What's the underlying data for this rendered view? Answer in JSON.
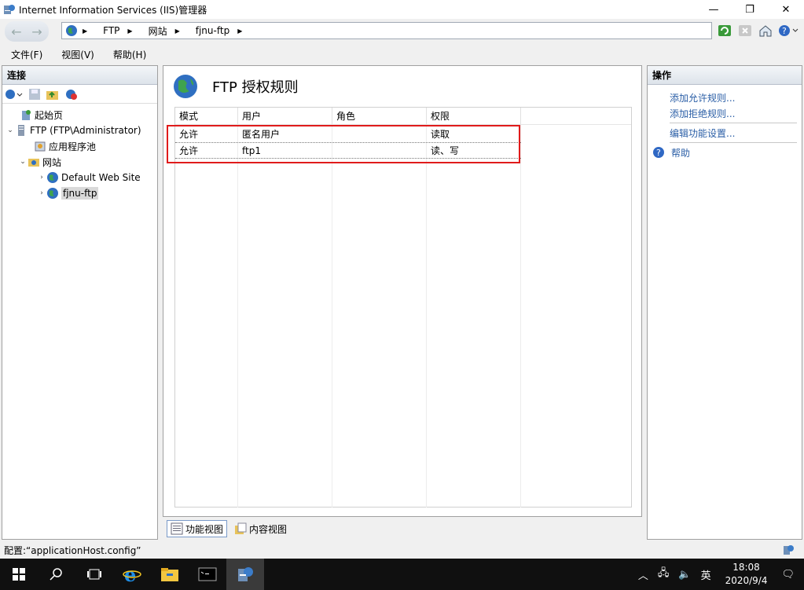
{
  "window": {
    "title": "Internet Information Services (IIS)管理器"
  },
  "address": {
    "crumbs": [
      "FTP",
      "网站",
      "fjnu-ftp"
    ]
  },
  "menu": {
    "items": [
      "文件(F)",
      "视图(V)",
      "帮助(H)"
    ]
  },
  "left": {
    "header": "连接",
    "tree": {
      "start_page": "起始页",
      "server": "FTP (FTP\\Administrator)",
      "app_pools": "应用程序池",
      "sites": "网站",
      "default_site": "Default Web Site",
      "fjnu_ftp": "fjnu-ftp"
    }
  },
  "center": {
    "title": "FTP 授权规则",
    "columns": [
      "模式",
      "用户",
      "角色",
      "权限"
    ],
    "rows": [
      {
        "mode": "允许",
        "user": "匿名用户",
        "role": "",
        "perm": "读取"
      },
      {
        "mode": "允许",
        "user": "ftp1",
        "role": "",
        "perm": "读、写"
      }
    ],
    "tabs": {
      "feature_view": "功能视图",
      "content_view": "内容视图"
    }
  },
  "right": {
    "header": "操作",
    "actions": [
      "添加允许规则...",
      "添加拒绝规则...",
      "编辑功能设置..."
    ],
    "help": "帮助"
  },
  "status": {
    "text": "配置:“applicationHost.config”"
  },
  "taskbar": {
    "time": "18:08",
    "date": "2020/9/4",
    "ime": "英"
  },
  "colors": {
    "highlight": "#e01b1b",
    "action_link": "#2a5ea6"
  }
}
